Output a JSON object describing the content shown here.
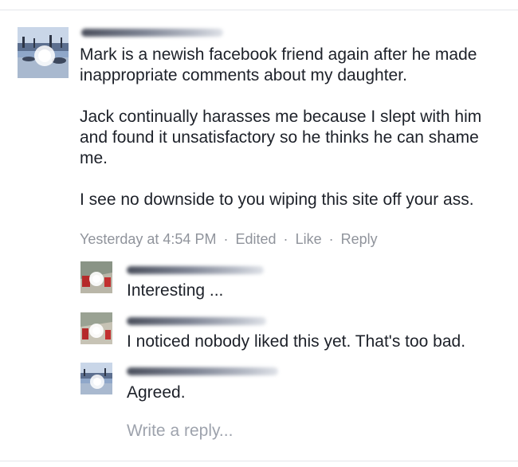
{
  "comment": {
    "author_name": "",
    "paragraphs": [
      "Mark is a newish facebook friend again after he made inappropriate comments about my daughter.",
      "Jack continually harasses me because I slept with him and found it unsatisfactory so he thinks he can shame me.",
      "I see no downside to you wiping this site off your ass."
    ],
    "timestamp": "Yesterday at 4:54 PM",
    "edited_label": "Edited",
    "like_label": "Like",
    "reply_label": "Reply",
    "separator": "·"
  },
  "replies": [
    {
      "author_name": "",
      "text": "Interesting ...",
      "avatar_icon": "profile-photo-icon"
    },
    {
      "author_name": "",
      "text": "I noticed nobody liked this yet. That's too bad.",
      "avatar_icon": "profile-photo-icon"
    },
    {
      "author_name": "",
      "text": "Agreed.",
      "avatar_icon": "profile-photo-icon"
    }
  ],
  "reply_input": {
    "placeholder": "Write a reply..."
  },
  "colors": {
    "text": "#1d2129",
    "meta": "#90949c",
    "placeholder": "#9ea3ad"
  }
}
